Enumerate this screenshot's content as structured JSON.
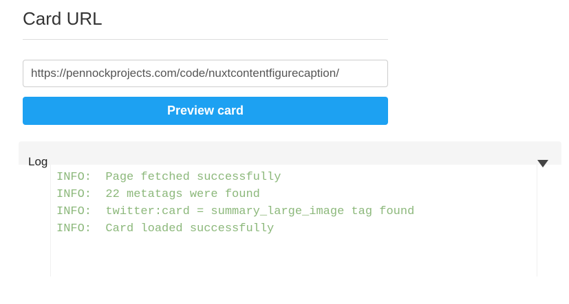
{
  "card": {
    "title": "Card URL",
    "url_value": "https://pennockprojects.com/code/nuxtcontentfigurecaption/",
    "preview_button_label": "Preview card",
    "accent_color": "#1da1f2"
  },
  "log": {
    "label": "Log",
    "toggle_icon": "triangle-down-icon",
    "lines": [
      "INFO:  Page fetched successfully",
      "INFO:  22 metatags were found",
      "INFO:  twitter:card = summary_large_image tag found",
      "INFO:  Card loaded successfully"
    ],
    "line_color": "#8cb87b"
  }
}
